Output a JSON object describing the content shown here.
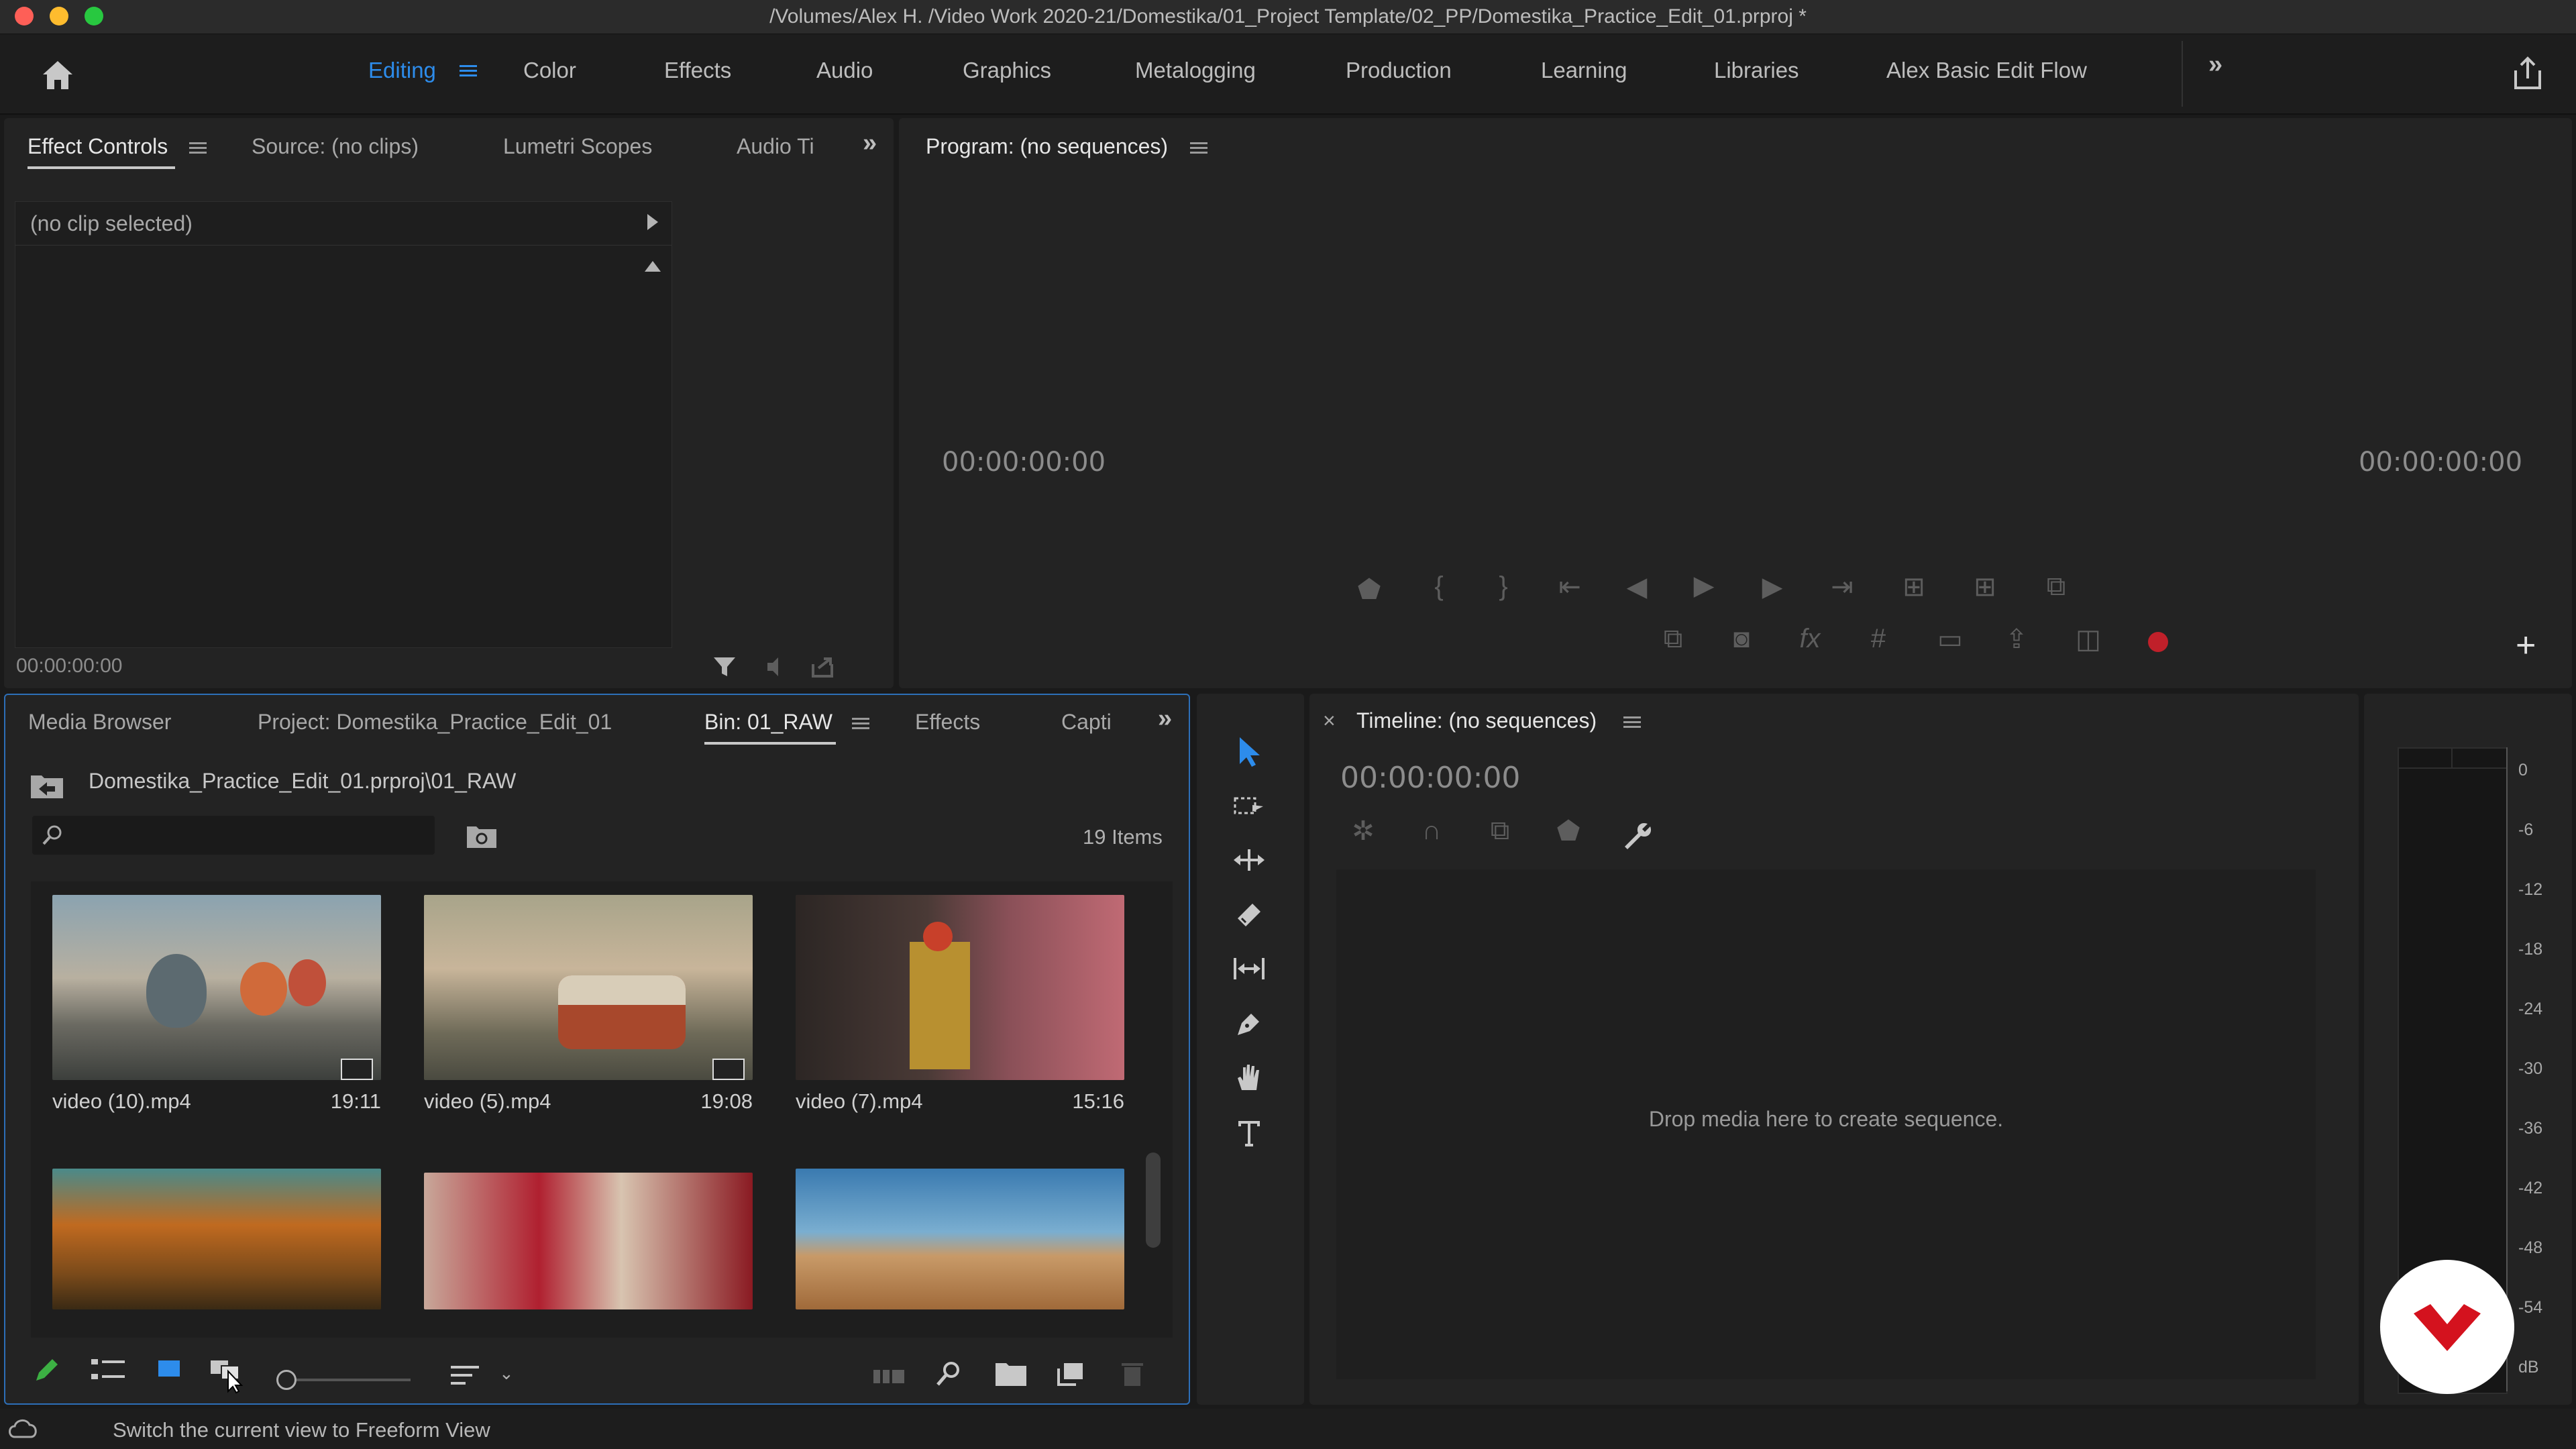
{
  "window": {
    "title": "/Volumes/Alex H. /Video Work 2020-21/Domestika/01_Project Template/02_PP/Domestika_Practice_Edit_01.prproj *"
  },
  "workspaces": {
    "items": [
      "Editing",
      "Color",
      "Effects",
      "Audio",
      "Graphics",
      "Metalogging",
      "Production",
      "Learning",
      "Libraries",
      "Alex Basic Edit Flow"
    ],
    "active": "Editing"
  },
  "source_panel": {
    "tabs": [
      "Effect Controls",
      "Source: (no clips)",
      "Lumetri Scopes",
      "Audio Ti"
    ],
    "no_clip": "(no clip selected)",
    "timecode": "00:00:00:00"
  },
  "program_panel": {
    "title": "Program: (no sequences)",
    "timecode_left": "00:00:00:00",
    "timecode_right": "00:00:00:00"
  },
  "project_panel": {
    "tabs": [
      "Media Browser",
      "Project: Domestika_Practice_Edit_01",
      "Bin: 01_RAW",
      "Effects",
      "Capti"
    ],
    "path": "Domestika_Practice_Edit_01.prproj\\01_RAW",
    "search_placeholder": "",
    "item_count": "19 Items",
    "clips": [
      {
        "name": "video (10).mp4",
        "duration": "19:11"
      },
      {
        "name": "video (5).mp4",
        "duration": "19:08"
      },
      {
        "name": "video (7).mp4",
        "duration": "15:16"
      },
      {
        "name": "",
        "duration": ""
      },
      {
        "name": "",
        "duration": ""
      },
      {
        "name": "",
        "duration": ""
      }
    ]
  },
  "timeline_panel": {
    "title": "Timeline: (no sequences)",
    "timecode": "00:00:00:00",
    "drop_hint": "Drop media here to create sequence."
  },
  "audio_meter": {
    "labels": [
      "0",
      "-6",
      "-12",
      "-18",
      "-24",
      "-30",
      "-36",
      "-42",
      "-48",
      "-54",
      "dB"
    ]
  },
  "status_bar": {
    "text": "Switch the current view to Freeform View"
  },
  "colors": {
    "accent": "#2d8ceb",
    "panel": "#232323",
    "background": "#1a1a1a",
    "record": "#c0202a"
  }
}
